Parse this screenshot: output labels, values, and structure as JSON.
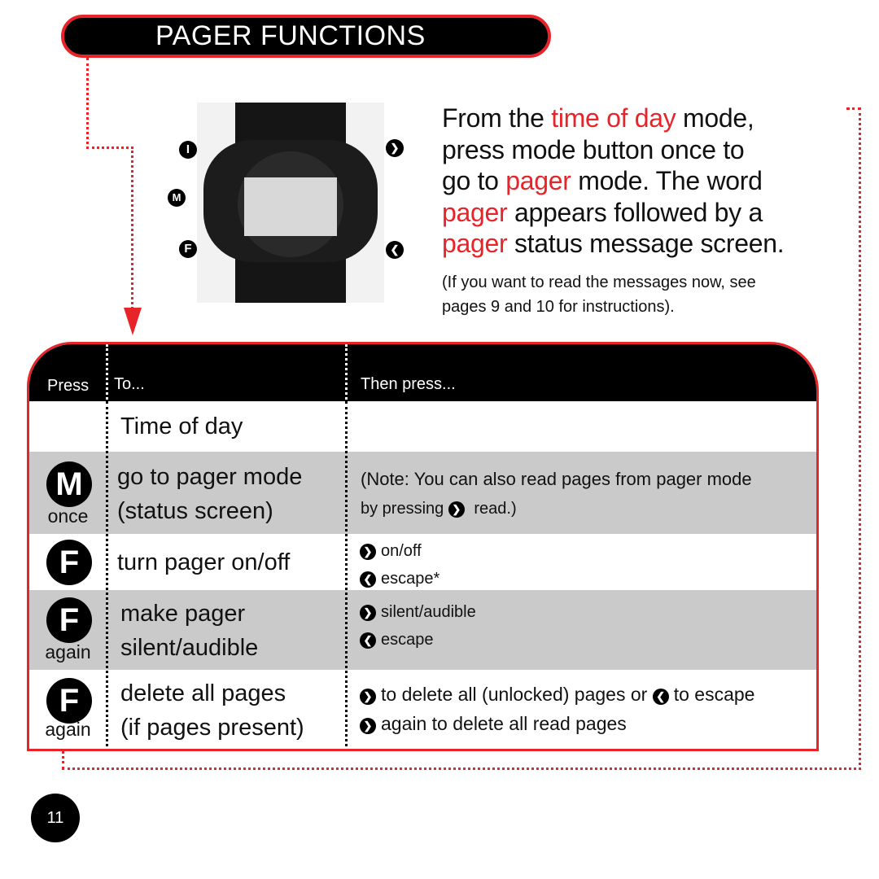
{
  "title": "PAGER FUNCTIONS",
  "watch_buttons": {
    "i": "I",
    "m": "M",
    "f": "F",
    "right": "❯",
    "left": "❮"
  },
  "intro": {
    "p1": "From the ",
    "p1_red": "time of day",
    "p1b": " mode,",
    "p2": "press mode button once to",
    "p3": "go to ",
    "p3_red": "pager",
    "p3b": " mode. The word",
    "p4_red": "pager",
    "p4": " appears followed by a",
    "p5_red": "pager",
    "p5": " status message screen.",
    "note1": "(If you want to read the messages now, see",
    "note2": "pages 9 and 10 for instructions)."
  },
  "table": {
    "headers": {
      "press": "Press",
      "to": "To...",
      "then": "Then press..."
    },
    "rows": [
      {
        "to1": "Time of day"
      },
      {
        "btn": "M",
        "sub": "once",
        "to1": "go to pager mode",
        "to2": "(status screen)",
        "then1": "(Note: You can also read pages from pager mode",
        "then2a": "by pressing ",
        "then2b": " read.)"
      },
      {
        "btn": "F",
        "to1": "turn pager on/off",
        "then1": "on/off",
        "then2": "escape*"
      },
      {
        "btn": "F",
        "sub": "again",
        "to1": "make pager",
        "to2": "silent/audible",
        "then1": "silent/audible",
        "then2": "escape"
      },
      {
        "btn": "F",
        "sub": "again",
        "to1": "delete all pages",
        "to2": "(if pages present)",
        "then1a": "to delete all (unlocked) pages or ",
        "then1b": "to escape",
        "then2": "again to delete all read pages"
      }
    ]
  },
  "page_number": "11",
  "colors": {
    "accent": "#e8242b",
    "row_gray": "#cacaca"
  }
}
